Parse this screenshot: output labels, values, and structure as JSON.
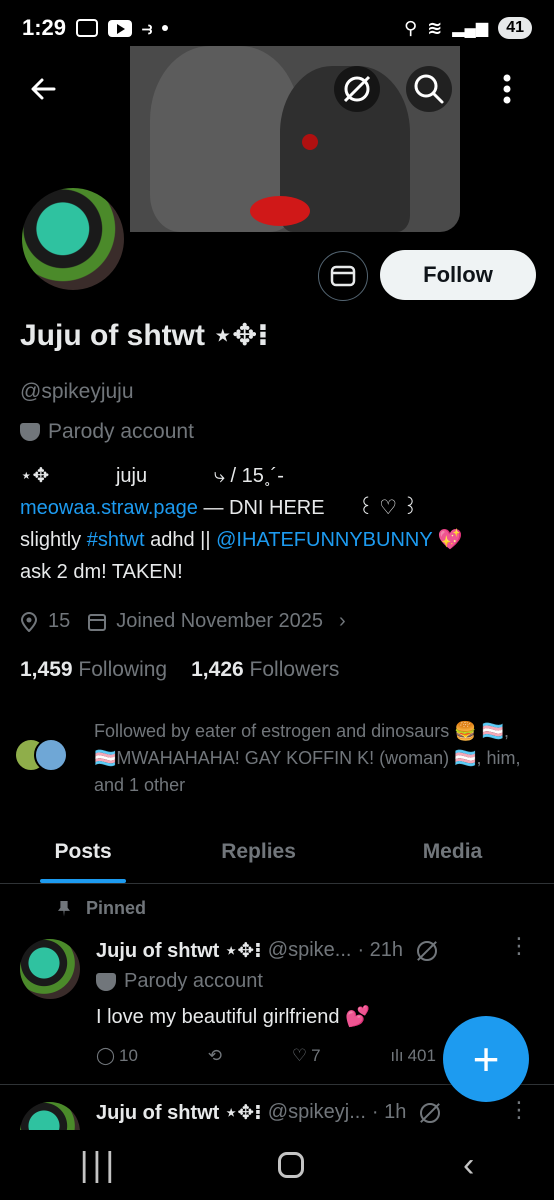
{
  "status_bar": {
    "time": "1:29",
    "battery": "41"
  },
  "header": {
    "back_icon": "arrow-left-icon",
    "grok_icon": "grok-icon",
    "search_icon": "search-icon",
    "more_icon": "more-vertical-icon"
  },
  "profile": {
    "display_name": "Juju of shtwt ⋆✥⁝",
    "handle": "@spikeyjuju",
    "label": "Parody account",
    "follow_label": "Follow",
    "bio_line1": "⋆✥            juju            ⤷ / 15˳´-",
    "bio_link": "meowaa.straw.page",
    "bio_line2_rest": " — DNI HERE      ꒰ ♡ ꒱",
    "bio_line3_pre": "slightly ",
    "bio_hashtag": "#shtwt",
    "bio_line3_mid": " adhd || ",
    "bio_mention": "@IHATEFUNNYBUNNY",
    "bio_line3_emoji": " 💖",
    "bio_line4": "ask 2 dm! TAKEN!",
    "location": "15",
    "joined": "Joined November 2025",
    "following_count": "1,459",
    "following_label": "Following",
    "followers_count": "1,426",
    "followers_label": "Followers",
    "followed_by": "Followed by eater of estrogen and dinosaurs 🍔 🏳️‍⚧️, 🏳️‍⚧️MWAHAHAHA! GAY KOFFIN K! (woman) 🏳️‍⚧️, him, and 1 other"
  },
  "tabs": [
    {
      "label": "Posts"
    },
    {
      "label": "Replies"
    },
    {
      "label": "Media"
    }
  ],
  "posts": [
    {
      "pinned_label": "Pinned",
      "name": "Juju of shtwt ⋆✥⁝",
      "handle": "@spike...",
      "time": "· 21h",
      "label": "Parody account",
      "text": "I love my beautiful girlfriend 💕",
      "replies": "10",
      "likes": "7",
      "views": "401"
    },
    {
      "name": "Juju of shtwt ⋆✥⁝",
      "handle": "@spikeyj...",
      "time": "· 1h"
    }
  ],
  "fab": {
    "icon": "plus-icon",
    "label": "+"
  },
  "colors": {
    "accent": "#1d9bf0",
    "background": "#000000",
    "muted": "#71767b"
  }
}
